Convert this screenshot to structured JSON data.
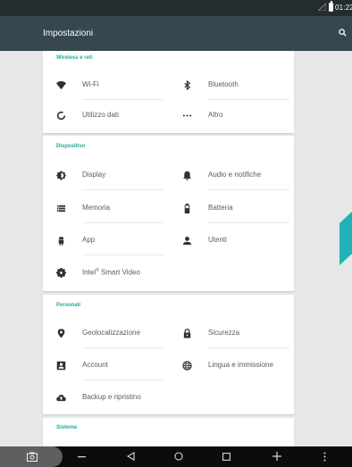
{
  "status_bar": {
    "time": "01:22"
  },
  "app_bar": {
    "title": "Impostazioni"
  },
  "sections": {
    "wireless": {
      "header": "Wireless e reti",
      "items": [
        {
          "label": "Wi-Fi",
          "icon": "wifi-icon"
        },
        {
          "label": "Bluetooth",
          "icon": "bluetooth-icon"
        },
        {
          "label": "Utilizzo dati",
          "icon": "data-usage-icon"
        },
        {
          "label": "Altro",
          "icon": "more-icon"
        }
      ]
    },
    "device": {
      "header": "Dispositivo",
      "items": [
        {
          "label": "Display",
          "icon": "display-icon"
        },
        {
          "label": "Audio e notifiche",
          "icon": "bell-icon"
        },
        {
          "label": "Memoria",
          "icon": "storage-icon"
        },
        {
          "label": "Batteria",
          "icon": "battery-icon"
        },
        {
          "label": "App",
          "icon": "android-icon"
        },
        {
          "label": "Utenti",
          "icon": "user-icon"
        },
        {
          "label": "Intel",
          "label_sup": "®",
          "label_rest": " Smart Video",
          "icon": "gear-icon"
        }
      ]
    },
    "personal": {
      "header": "Personali",
      "items": [
        {
          "label": "Geolocalizzazione",
          "icon": "location-icon"
        },
        {
          "label": "Sicurezza",
          "icon": "lock-icon"
        },
        {
          "label": "Account",
          "icon": "account-icon"
        },
        {
          "label": "Lingua e immissione",
          "icon": "globe-icon"
        },
        {
          "label": "Backup e ripristino",
          "icon": "cloud-upload-icon"
        }
      ]
    },
    "system": {
      "header": "Sistema"
    }
  },
  "colors": {
    "accent": "#26a69a",
    "icon": "#2a3338",
    "app_bar": "#36474f",
    "status_bar": "#252c30",
    "side_tab": "#1fb2b6"
  }
}
